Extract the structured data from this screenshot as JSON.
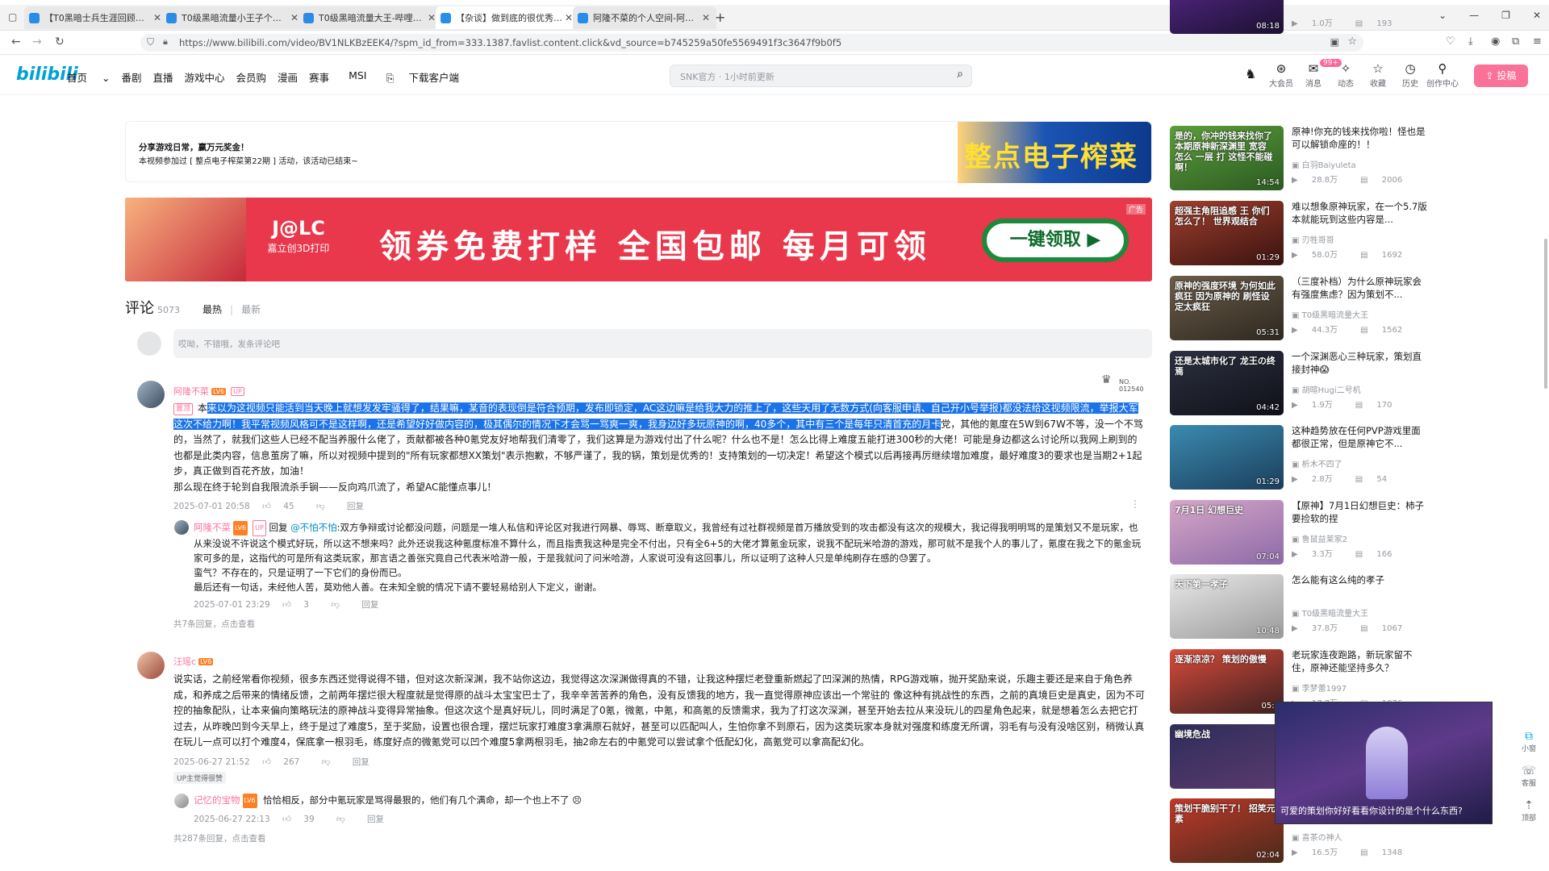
{
  "browser": {
    "tabs": [
      {
        "label": "【T0黑暗士兵生涯回顾】狗粮玩"
      },
      {
        "label": "T0级黑暗流量小王子个人动态"
      },
      {
        "label": "T0级黑暗流量大王-哔哩哔哩"
      },
      {
        "label": "【杂谈】做到底的很优秀！宣言"
      },
      {
        "label": "阿隆不菜的个人空间-阿隆不菜"
      }
    ],
    "new_tab": "+",
    "url": "https://www.bilibili.com/video/BV1NLKBzEEK4/?spm_id_from=333.1387.favlist.content.click&vd_source=b745259a50fe5569491f3c3647f9b0f5"
  },
  "header": {
    "logo": "bilibili",
    "nav": [
      "首页",
      "番剧",
      "直播",
      "游戏中心",
      "会员购",
      "漫画",
      "赛事",
      "MSI",
      "下载客户端"
    ],
    "search_placeholder": "SNK官方 · 1小时前更新",
    "icons": [
      {
        "label": "大会员",
        "icon": "vip-icon"
      },
      {
        "label": "消息",
        "icon": "message-icon"
      },
      {
        "label": "动态",
        "icon": "dynamic-icon"
      },
      {
        "label": "收藏",
        "icon": "favorite-icon"
      },
      {
        "label": "历史",
        "icon": "history-icon"
      },
      {
        "label": "创作中心",
        "icon": "creator-icon"
      }
    ],
    "message_badge": "99+",
    "upload": "投稿"
  },
  "activity": {
    "title": "分享游戏日常，赢万元奖金！",
    "desc": "本视频参加过 [ 整点电子榨菜第22期 ] 活动，该活动已结束~",
    "image_text": "整点电子榨菜"
  },
  "ad": {
    "logo_big": "J@LC",
    "logo_small": "嘉立创3D打印",
    "slogan": "领券免费打样 全国包邮 每月可领",
    "button": "一键领取 ▶",
    "tag": "广告"
  },
  "comments": {
    "title": "评论",
    "count": "5073",
    "sort_hot": "最热",
    "sort_new": "最新",
    "reply_placeholder": "哎呦，不错哦，发条评论吧",
    "items": [
      {
        "user": "阿隆不菜",
        "level": "LV6",
        "up_badge": "UP",
        "pinned": "置顶",
        "text_prefix": "本",
        "text_selected": "来以为这视频只能活到当天晚上就想发发牢骚得了，结果嘛，某音的表现倒是符合预期，发布即锁定，AC这边嘛是给我大力的推上了，这些天用了无数方式(向客服申请、自己开小号举报)都没法给这视频限流，举报大军这次不给力啊！我平常视频风格可不是这样啊，还是希望好好做内容的，极其偶尔的情况下才会骂一骂爽一爽，我身边好多玩原神的啊，40多个，其中有三个是每年只清首充的月卡",
        "text_rest": "党，其他的氪度在5W到67W不等，没一个不骂的，当然了，就我们这些人已经不配当养服什么佬了，贡献都被各种0氪党友好地帮我们清零了，我们这算是为游戏付出了什么呢？什么也不是！怎么比得上难度五能打进300秒的大佬！可能是身边都这么讨论所以我网上刷到的也都是此类内容，信息茧房了嘛，所以对视频中提到的\"所有玩家都想XX策划\"表示抱歉，不够严谨了，我的锅，策划是优秀的！支持策划的一切决定！希望这个模式以后再接再厉继续增加难度，最好难度3的要求也是当期2+1起步，真正做到百花齐放，加油！",
        "text_last": "那么现在终于轮到自我限流杀手锏——反向鸡爪流了，希望AC能懂点事儿！",
        "date": "2025-07-01 20:58",
        "likes": "45",
        "reply_label": "回复",
        "fan_badge_no": "NO.",
        "fan_badge_num": "012540",
        "sub": {
          "user": "阿隆不菜",
          "level": "LV6",
          "up_badge": "UP",
          "reply_word": "回复",
          "mention": "@不怕不怕",
          "text": ":双方争辩或讨论都没问题，问题是一堆人私信和评论区对我进行网暴、辱骂、断章取义，我曾经有过社群视频是首万播放受到的攻击都没有这次的规模大，我记得我明明骂的是策划又不是玩家，也从来没说不许说这个模式好玩，所以这不想来吗？此外还说我这种氪度标准不算什么，而且指责我这种是完全不付出，只有全6+5的大佬才算氪金玩家，说我不配玩米哈游的游戏，那可就不是我个人的事儿了，氪度在我之下的氪金玩家可多的是，这指代的可是所有这类玩家，那言语之善张究竟自己代表米哈游一般，于是我就问了问米哈游，人家说可没有这回事儿，所以证明了这种人只是单纯刷存在感的",
          "text_end": "罢了。",
          "line2": "蛮气？不存在的，只是证明了一下它们的身份而已。",
          "line3": "最后还有一句话，未经他人苦，莫劝他人善。在未知全貌的情况下请不要轻易给别人下定义，谢谢。",
          "date": "2025-07-01 23:29",
          "likes": "3",
          "reply_label": "回复"
        },
        "more": "共7条回复，点击查看"
      },
      {
        "user": "汪瑶c",
        "level": "LV6",
        "text": "说实话，之前经常看你视频，很多东西还觉得说得不错，但对这次新深渊，我不站你这边，我觉得这次深渊做得真的不错，让我这种摆烂老登重新燃起了凹深渊的热情，RPG游戏嘛，抛开奖励来说，乐趣主要还是来自于角色养成，和养成之后带来的情绪反馈，之前两年摆烂很大程度就是觉得原的战斗太宝宝巴士了，我辛辛苦苦养的角色，没有反馈我的地方，我一直觉得原神应该出一个常驻的 像这种有挑战性的东西，之前的真境巨史是真史，因为不可控的抽象配队，让本来偏向策略玩法的原神战斗变得异常抽象。但这次这个是真好玩儿，同时满足了0氪，微氪，中氪，和高氪的反馈需求，我为了打这次深渊，甚至开始去拉从来没玩儿的四星角色起来，就是想着怎么去把它打过去，从昨晚凹到今天早上，终于是过了难度5，至于奖励，设置也很合理，摆烂玩家打难度3拿满原石就好，甚至可以匹配叫人，生怕你拿不到原石，因为这类玩家本身就对强度和练度无所谓，羽毛有与没有没啥区别，稍微认真在玩儿一点可以打个难度4，保底拿一根羽毛，练度好点的微氪党可以凹个难度5拿两根羽毛，抽2命左右的中氪党可以尝试拿个低配幻化，高氪党可以拿高配幻化。",
        "date": "2025-06-27 21:52",
        "likes": "267",
        "reply_label": "回复",
        "up_fav": "UP主觉得很赞",
        "sub": {
          "user": "记忆的宝物",
          "level": "LV6",
          "text": "恰恰相反，部分中氪玩家是骂得最狠的，他们有几个满命，却一个也上不了",
          "date": "2025-06-27 22:13",
          "likes": "39",
          "reply_label": "回复"
        },
        "more": "共287条回复，点击查看"
      }
    ]
  },
  "sidebar": {
    "videos": [
      {
        "title": "",
        "up": "",
        "views": "1.0万",
        "danmaku": "193",
        "duration": "08:18",
        "thumb_text": "",
        "color_a": "#5b2a91",
        "color_b": "#1b1030"
      },
      {
        "title": "原神!你充的钱来找你啦！怪也是可以解锁命座的！！",
        "up": "白羽Baiyuleta",
        "views": "28.8万",
        "danmaku": "2006",
        "duration": "14:54",
        "thumb_text": "是的，你冲的钱来找你了 本期原神新深渊里 宽容 怎么 一层 打 这怪不能碰啊！",
        "color_a": "#5c9e3a",
        "color_b": "#2b5a22"
      },
      {
        "title": "难以想象原神玩家，在一个5.7版本就能玩到这些内容是...",
        "up": "刃牲哥哥",
        "views": "58.0万",
        "danmaku": "1692",
        "duration": "01:29",
        "thumb_text": "超强主角阻追感 王 你们怎么了！ 世界观结合",
        "color_a": "#a0402d",
        "color_b": "#3a1210"
      },
      {
        "title": "（三度补档）为什么原神玩家会有强度焦虑？因为策划不...",
        "up": "T0级黑暗流量大王",
        "views": "44.3万",
        "danmaku": "1562",
        "duration": "05:31",
        "thumb_text": "原神的强度环境 为何如此疯狂 因为原神的 刷怪设定太疯狂",
        "color_a": "#6b5d4a",
        "color_b": "#2e2820"
      },
      {
        "title": "一个深渊恶心三种玩家，策划直接封神😱",
        "up": "胡暄Hugi二号机",
        "views": "1.9万",
        "danmaku": "170",
        "duration": "04:42",
        "thumb_text": "还是太城市化了 龙王の终焉",
        "color_a": "#2d3040",
        "color_b": "#0f1018"
      },
      {
        "title": "这种趋势放在任何PVP游戏里面都很正常，但是原神它不...",
        "up": "析木不四了",
        "views": "2.8万",
        "danmaku": "54",
        "duration": "01:29",
        "thumb_text": "",
        "color_a": "#3b8bb0",
        "color_b": "#1b3e5c"
      },
      {
        "title": "【原神】7月1日幻想巨史：柿子要捡软的捏",
        "up": "鲁鼠益莱家2",
        "views": "3.3万",
        "danmaku": "166",
        "duration": "07:04",
        "thumb_text": "7月1日 幻想巨史",
        "color_a": "#d7a7c7",
        "color_b": "#8c6aa8"
      },
      {
        "title": "怎么能有这么纯的孝子",
        "up": "T0级黑暗流量大王",
        "views": "37.8万",
        "danmaku": "1067",
        "duration": "10:48",
        "thumb_text": "天下第一孝子",
        "color_a": "#e9e9e9",
        "color_b": "#9a9a9a"
      },
      {
        "title": "老玩家连夜跑路，新玩家留不住，原神还能坚持多久？",
        "up": "李梦蕾1997",
        "views": "17.7万",
        "danmaku": "1876",
        "duration": "05:0",
        "thumb_text": "逐渐凉凉？ 策划的傲慢",
        "color_a": "#d94b3b",
        "color_b": "#3c2020"
      },
      {
        "title": "",
        "up": "",
        "views": "",
        "danmaku": "",
        "duration": "",
        "thumb_text": "幽境危战",
        "color_a": "#2e2d5a",
        "color_b": "#5a3a6e"
      },
      {
        "title": "",
        "up": "喜茶の神人",
        "views": "16.5万",
        "danmaku": "1348",
        "duration": "02:04",
        "thumb_text": "策划干脆别干了！ 招笑元素",
        "color_a": "#c0392b",
        "color_b": "#4a2a1a"
      }
    ]
  },
  "miniplayer": {
    "caption": "可爱的策划你好好看看你设计的是个什么东西?"
  },
  "floatbar": {
    "items": [
      {
        "label": "小窗",
        "icon": "mini-window-icon"
      },
      {
        "label": "客服",
        "icon": "service-icon"
      },
      {
        "label": "顶部",
        "icon": "top-icon"
      }
    ]
  }
}
